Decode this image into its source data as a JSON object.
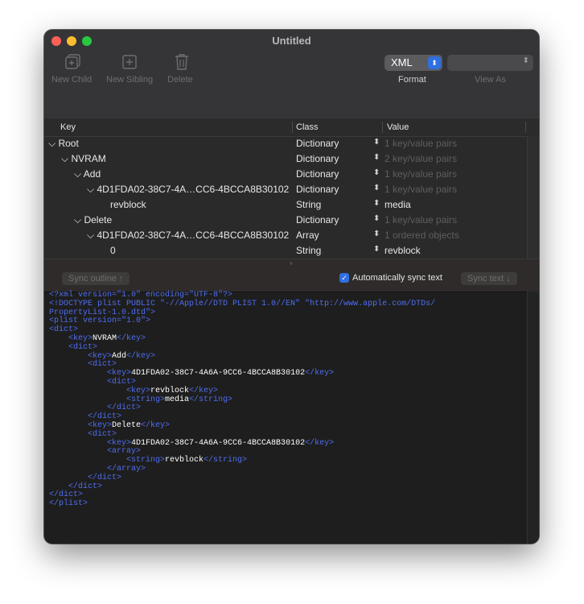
{
  "window": {
    "title": "Untitled"
  },
  "toolbar": {
    "new_child": "New Child",
    "new_sibling": "New Sibling",
    "delete": "Delete",
    "format_value": "XML",
    "format_label": "Format",
    "view_as_value": "",
    "view_as_label": "View As"
  },
  "outline": {
    "headers": {
      "key": "Key",
      "class": "Class",
      "value": "Value"
    },
    "rows": [
      {
        "key": "Root",
        "class": "Dictionary",
        "value": "1 key/value pairs",
        "value_dim": true
      },
      {
        "key": "NVRAM",
        "class": "Dictionary",
        "value": "2 key/value pairs",
        "value_dim": true
      },
      {
        "key": "Add",
        "class": "Dictionary",
        "value": "1 key/value pairs",
        "value_dim": true
      },
      {
        "key": "4D1FDA02-38C7-4A…CC6-4BCCA8B30102",
        "class": "Dictionary",
        "value": "1 key/value pairs",
        "value_dim": true
      },
      {
        "key": "revblock",
        "class": "String",
        "value": "media",
        "value_dim": false
      },
      {
        "key": "Delete",
        "class": "Dictionary",
        "value": "1 key/value pairs",
        "value_dim": true
      },
      {
        "key": "4D1FDA02-38C7-4A…CC6-4BCCA8B30102",
        "class": "Array",
        "value": "1 ordered objects",
        "value_dim": true
      },
      {
        "key": "0",
        "class": "String",
        "value": "revblock",
        "value_dim": false
      }
    ]
  },
  "sync": {
    "outline_label": "Sync outline ↑",
    "auto_sync_label": "Automatically sync text",
    "auto_sync_checked": true,
    "text_label": "Sync text ↓"
  },
  "xml_lines": [
    [
      [
        "t",
        "<?xml version=\"1.0\" encoding=\"UTF-8\"?>"
      ]
    ],
    [
      [
        "t",
        "<!DOCTYPE plist PUBLIC \"-//Apple//DTD PLIST 1.0//EN\" \"http://www.apple.com/DTDs/"
      ]
    ],
    [
      [
        "t",
        "PropertyList-1.0.dtd\">"
      ]
    ],
    [
      [
        "t",
        "<plist version=\"1.0\">"
      ]
    ],
    [
      [
        "t",
        "<dict>"
      ]
    ],
    [
      [
        "t",
        "    <key>"
      ],
      [
        "x",
        "NVRAM"
      ],
      [
        "t",
        "</key>"
      ]
    ],
    [
      [
        "t",
        "    <dict>"
      ]
    ],
    [
      [
        "t",
        "        <key>"
      ],
      [
        "x",
        "Add"
      ],
      [
        "t",
        "</key>"
      ]
    ],
    [
      [
        "t",
        "        <dict>"
      ]
    ],
    [
      [
        "t",
        "            <key>"
      ],
      [
        "x",
        "4D1FDA02-38C7-4A6A-9CC6-4BCCA8B30102"
      ],
      [
        "t",
        "</key>"
      ]
    ],
    [
      [
        "t",
        "            <dict>"
      ]
    ],
    [
      [
        "t",
        "                <key>"
      ],
      [
        "x",
        "revblock"
      ],
      [
        "t",
        "</key>"
      ]
    ],
    [
      [
        "t",
        "                <string>"
      ],
      [
        "x",
        "media"
      ],
      [
        "t",
        "</string>"
      ]
    ],
    [
      [
        "t",
        "            </dict>"
      ]
    ],
    [
      [
        "t",
        "        </dict>"
      ]
    ],
    [
      [
        "t",
        "        <key>"
      ],
      [
        "x",
        "Delete"
      ],
      [
        "t",
        "</key>"
      ]
    ],
    [
      [
        "t",
        "        <dict>"
      ]
    ],
    [
      [
        "t",
        "            <key>"
      ],
      [
        "x",
        "4D1FDA02-38C7-4A6A-9CC6-4BCCA8B30102"
      ],
      [
        "t",
        "</key>"
      ]
    ],
    [
      [
        "t",
        "            <array>"
      ]
    ],
    [
      [
        "t",
        "                <string>"
      ],
      [
        "x",
        "revblock"
      ],
      [
        "t",
        "</string>"
      ]
    ],
    [
      [
        "t",
        "            </array>"
      ]
    ],
    [
      [
        "t",
        "        </dict>"
      ]
    ],
    [
      [
        "t",
        "    </dict>"
      ]
    ],
    [
      [
        "t",
        "</dict>"
      ]
    ],
    [
      [
        "t",
        "</plist>"
      ]
    ]
  ]
}
